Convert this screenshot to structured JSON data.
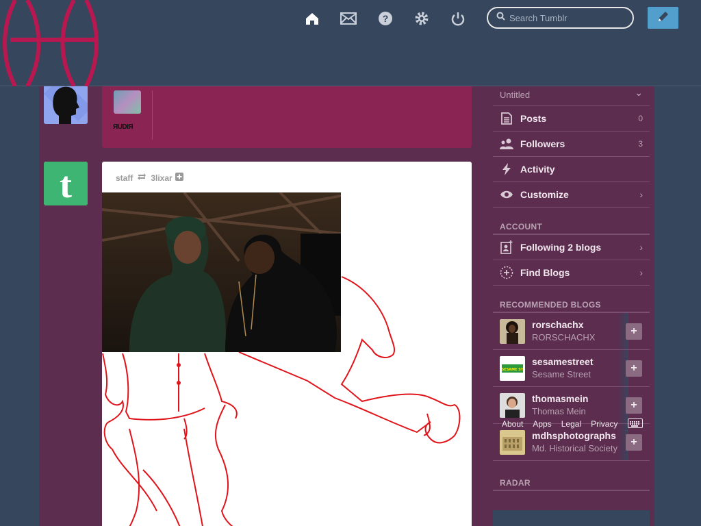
{
  "header": {
    "search_placeholder": "Search Tumblr",
    "nav": [
      "home-icon",
      "inbox-icon",
      "help-icon",
      "settings-icon",
      "logout-icon"
    ]
  },
  "top_post": {
    "word": "ЯUDIЯ"
  },
  "post": {
    "author": "staff",
    "reblogged_from": "3lixar"
  },
  "sidebar": {
    "blog_title": "Untitled",
    "blog_items": [
      {
        "label": "Posts",
        "count": "0",
        "icon": "posts-icon"
      },
      {
        "label": "Followers",
        "count": "3",
        "icon": "followers-icon"
      },
      {
        "label": "Activity",
        "count": "",
        "icon": "activity-icon"
      },
      {
        "label": "Customize",
        "count": "",
        "icon": "eye-icon"
      }
    ],
    "account_title": "ACCOUNT",
    "account_items": [
      {
        "label": "Following 2 blogs",
        "icon": "following-icon"
      },
      {
        "label": "Find Blogs",
        "icon": "find-blogs-icon"
      }
    ],
    "recommended_title": "RECOMMENDED BLOGS",
    "recommended": [
      {
        "name": "rorschachx",
        "title": "RORSCHACHX"
      },
      {
        "name": "sesamestreet",
        "title": "Sesame Street"
      },
      {
        "name": "thomasmein",
        "title": "Thomas Mein"
      },
      {
        "name": "mdhsphotographs",
        "title": "Md. Historical Society"
      }
    ],
    "radar_title": "RADAR"
  },
  "footer": {
    "links": [
      "About",
      "Apps",
      "Legal",
      "Privacy"
    ]
  },
  "colors": {
    "header_bg": "#36465d",
    "page_bg": "#5c2d4f",
    "accent_blue": "#529ecc",
    "staff_green": "#3fb574",
    "logo_red": "#b8174f"
  }
}
